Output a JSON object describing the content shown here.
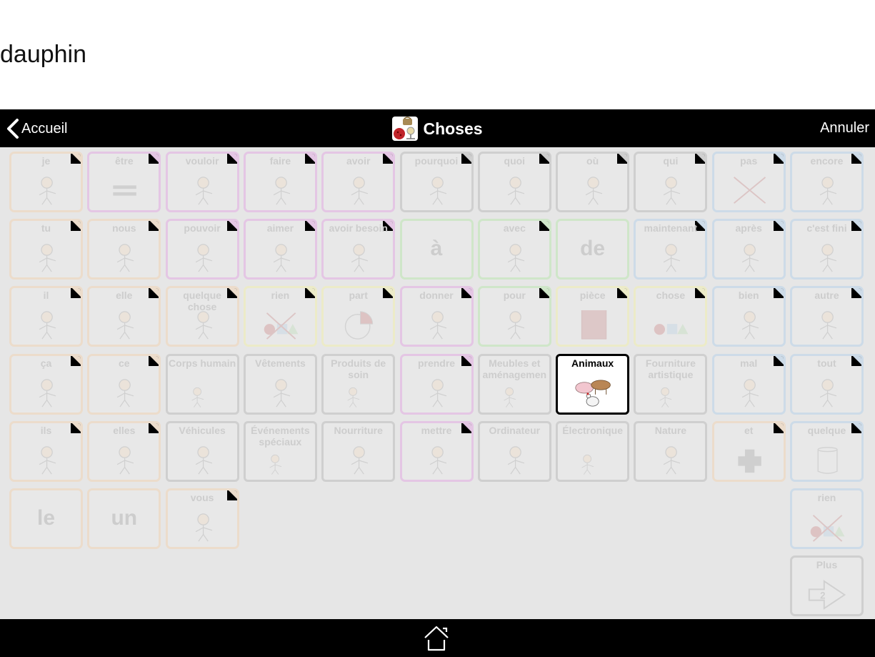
{
  "message_bar": {
    "text": "dauphin"
  },
  "topbar": {
    "back_label": "Accueil",
    "title": "Choses",
    "title_icon": "things-icon",
    "cancel_label": "Annuler"
  },
  "colors": {
    "orange": "#ecdccb",
    "purple": "#e4c6e4",
    "grey": "#cfcfcf",
    "green": "#cfe6c9",
    "blue": "#cddbe8",
    "yellow": "#ecebc8",
    "folder": "#cfcfcf",
    "active_border": "#000000"
  },
  "grid": {
    "rows": [
      [
        {
          "label": "je",
          "color": "orange",
          "type": "word",
          "icon": "person-pointing-self-icon"
        },
        {
          "label": "être",
          "color": "purple",
          "type": "word",
          "icon": "equals-icon"
        },
        {
          "label": "vouloir",
          "color": "purple",
          "type": "word",
          "icon": "person-reaching-icon"
        },
        {
          "label": "faire",
          "color": "purple",
          "type": "word",
          "icon": "person-hammer-icon"
        },
        {
          "label": "avoir",
          "color": "purple",
          "type": "word",
          "icon": "person-holding-icon"
        },
        {
          "label": "pourquoi",
          "color": "grey",
          "type": "word",
          "icon": "person-question-icon"
        },
        {
          "label": "quoi",
          "color": "grey",
          "type": "word",
          "icon": "person-shrug-question-icon"
        },
        {
          "label": "où",
          "color": "grey",
          "type": "word",
          "icon": "person-looking-question-icon"
        },
        {
          "label": "qui",
          "color": "grey",
          "type": "word",
          "icon": "person-who-icon"
        },
        {
          "label": "pas",
          "color": "blue",
          "type": "word",
          "icon": "cross-icon"
        },
        {
          "label": "encore",
          "color": "blue",
          "type": "word",
          "icon": "repeat-arrows-icon"
        }
      ],
      [
        {
          "label": "tu",
          "color": "orange",
          "type": "word",
          "icon": "person-pointing-other-icon"
        },
        {
          "label": "nous",
          "color": "orange",
          "type": "word",
          "icon": "two-faces-icon"
        },
        {
          "label": "pouvoir",
          "color": "purple",
          "type": "word",
          "icon": "person-strong-icon"
        },
        {
          "label": "aimer",
          "color": "purple",
          "type": "word",
          "icon": "person-love-icon"
        },
        {
          "label": "avoir besoin",
          "color": "purple",
          "type": "word",
          "icon": "hands-need-icon"
        },
        {
          "label": "à",
          "color": "green",
          "type": "text",
          "icon": ""
        },
        {
          "label": "avec",
          "color": "green",
          "type": "word",
          "icon": "squares-together-icon"
        },
        {
          "label": "de",
          "color": "green",
          "type": "text",
          "icon": ""
        },
        {
          "label": "maintenant",
          "color": "blue",
          "type": "word",
          "icon": "person-clock-icon"
        },
        {
          "label": "après",
          "color": "blue",
          "type": "word",
          "icon": "clock-after-icon"
        },
        {
          "label": "c'est fini",
          "color": "blue",
          "type": "word",
          "icon": "person-finished-icon"
        }
      ],
      [
        {
          "label": "il",
          "color": "orange",
          "type": "word",
          "icon": "boy-face-icon"
        },
        {
          "label": "elle",
          "color": "orange",
          "type": "word",
          "icon": "girl-face-icon"
        },
        {
          "label": "quelque chose",
          "color": "orange",
          "type": "word",
          "icon": "something-question-icon"
        },
        {
          "label": "rien",
          "color": "yellow",
          "type": "word",
          "icon": "nothing-shapes-icon"
        },
        {
          "label": "part",
          "color": "yellow",
          "type": "word",
          "icon": "pie-part-icon"
        },
        {
          "label": "donner",
          "color": "purple",
          "type": "word",
          "icon": "person-giving-icon"
        },
        {
          "label": "pour",
          "color": "green",
          "type": "word",
          "icon": "gift-tag-icon"
        },
        {
          "label": "pièce",
          "color": "yellow",
          "type": "word",
          "icon": "square-piece-icon"
        },
        {
          "label": "chose",
          "color": "yellow",
          "type": "word",
          "icon": "shapes-icon"
        },
        {
          "label": "bien",
          "color": "blue",
          "type": "word",
          "icon": "person-thumbs-up-icon"
        },
        {
          "label": "autre",
          "color": "blue",
          "type": "word",
          "icon": "other-shapes-icon"
        }
      ],
      [
        {
          "label": "ça",
          "color": "orange",
          "type": "word",
          "icon": "person-pointing-that-icon"
        },
        {
          "label": "ce",
          "color": "orange",
          "type": "word",
          "icon": "hand-pointing-square-icon"
        },
        {
          "label": "Corps humain",
          "color": "folder",
          "type": "folder",
          "icon": "body-parts-icon"
        },
        {
          "label": "Vêtements",
          "color": "folder",
          "type": "folder",
          "icon": "clothes-icon"
        },
        {
          "label": "Produits de soin",
          "color": "folder",
          "type": "folder",
          "icon": "care-products-icon"
        },
        {
          "label": "prendre",
          "color": "purple",
          "type": "word",
          "icon": "person-taking-icon"
        },
        {
          "label": "Meubles et aménagemen",
          "color": "folder",
          "type": "folder",
          "icon": "furniture-icon"
        },
        {
          "label": "Animaux",
          "color": "folder",
          "type": "folder",
          "icon": "animals-icon",
          "active": true
        },
        {
          "label": "Fourniture artistique",
          "color": "folder",
          "type": "folder",
          "icon": "art-supplies-icon"
        },
        {
          "label": "mal",
          "color": "blue",
          "type": "word",
          "icon": "person-thumbs-down-icon"
        },
        {
          "label": "tout",
          "color": "blue",
          "type": "word",
          "icon": "all-squares-icon"
        }
      ],
      [
        {
          "label": "ils",
          "color": "orange",
          "type": "word",
          "icon": "three-people-icon"
        },
        {
          "label": "elles",
          "color": "orange",
          "type": "word",
          "icon": "three-women-icon"
        },
        {
          "label": "Véhicules",
          "color": "folder",
          "type": "folder",
          "icon": "vehicles-icon"
        },
        {
          "label": "Événements spéciaux",
          "color": "folder",
          "type": "folder",
          "icon": "cake-icon"
        },
        {
          "label": "Nourriture",
          "color": "folder",
          "type": "folder",
          "icon": "food-icon"
        },
        {
          "label": "mettre",
          "color": "purple",
          "type": "word",
          "icon": "person-putting-icon"
        },
        {
          "label": "Ordinateur",
          "color": "folder",
          "type": "folder",
          "icon": "computer-icon"
        },
        {
          "label": "Électronique",
          "color": "folder",
          "type": "folder",
          "icon": "boombox-icon"
        },
        {
          "label": "Nature",
          "color": "folder",
          "type": "folder",
          "icon": "forest-icon"
        },
        {
          "label": "et",
          "color": "orange",
          "type": "word",
          "icon": "plus-icon"
        },
        {
          "label": "quelque",
          "color": "blue",
          "type": "word",
          "icon": "glass-icon"
        }
      ],
      [
        {
          "label": "le",
          "color": "orange",
          "type": "text",
          "icon": ""
        },
        {
          "label": "un",
          "color": "orange",
          "type": "text",
          "icon": ""
        },
        {
          "label": "vous",
          "color": "orange",
          "type": "word",
          "icon": "person-pointing-group-icon"
        },
        null,
        null,
        null,
        null,
        null,
        null,
        null,
        {
          "label": "rien",
          "color": "blue",
          "type": "word",
          "icon": "nothing-shapes-icon",
          "nocorner": true
        }
      ],
      [
        null,
        null,
        null,
        null,
        null,
        null,
        null,
        null,
        null,
        null,
        {
          "label": "Plus",
          "color": "grey",
          "type": "more",
          "icon": "next-page-arrow-icon",
          "page": "2"
        }
      ]
    ]
  },
  "bottombar": {
    "home_icon": "home-icon"
  }
}
